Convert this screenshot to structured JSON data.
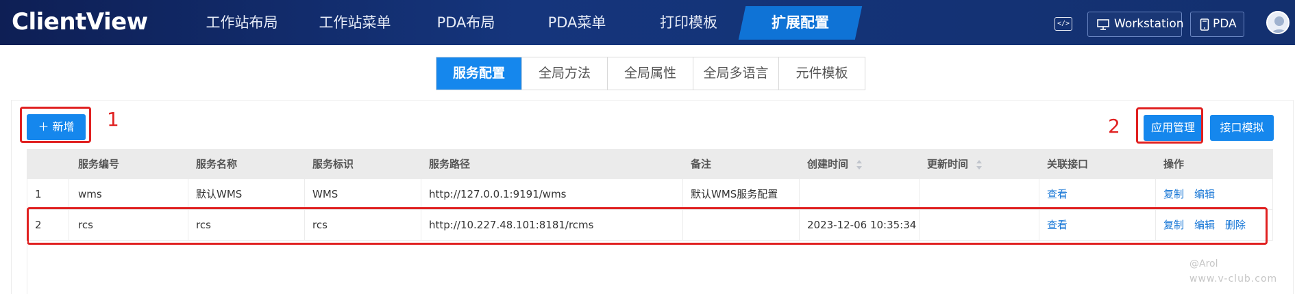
{
  "app": {
    "title": "ClientView"
  },
  "nav": {
    "items": [
      {
        "label": "工作站布局"
      },
      {
        "label": "工作站菜单"
      },
      {
        "label": "PDA布局"
      },
      {
        "label": "PDA菜单"
      },
      {
        "label": "打印模板"
      },
      {
        "label": "扩展配置"
      }
    ],
    "active_index": 5
  },
  "topright": {
    "workstation_label": "Workstation",
    "pda_label": "PDA",
    "code_icon_text": "</>"
  },
  "subtabs": [
    {
      "label": "服务配置"
    },
    {
      "label": "全局方法"
    },
    {
      "label": "全局属性"
    },
    {
      "label": "全局多语言"
    },
    {
      "label": "元件模板"
    }
  ],
  "toolbar": {
    "add_label": "＋ 新增",
    "app_manage_label": "应用管理",
    "api_mock_label": "接口模拟"
  },
  "annotations": {
    "one": "1",
    "two": "2"
  },
  "table": {
    "columns": [
      "服务编号",
      "服务名称",
      "服务标识",
      "服务路径",
      "备注",
      "创建时间",
      "更新时间",
      "关联接口",
      "操作"
    ],
    "rows": [
      {
        "index": "1",
        "code": "wms",
        "name": "默认WMS",
        "id": "WMS",
        "path": "http://127.0.0.1:9191/wms",
        "remark": "默认WMS服务配置",
        "created": "",
        "updated": "",
        "link": "查看",
        "actions": [
          "复制",
          "编辑"
        ]
      },
      {
        "index": "2",
        "code": "rcs",
        "name": "rcs",
        "id": "rcs",
        "path": "http://10.227.48.101:8181/rcms",
        "remark": "",
        "created": "2023-12-06 10:35:34",
        "updated": "",
        "link": "查看",
        "actions": [
          "复制",
          "编辑",
          "删除"
        ]
      }
    ]
  },
  "watermark": {
    "line1": "@Arol",
    "line2": "www.v-club.com"
  },
  "colors": {
    "nav_bg": "#13306f",
    "accent": "#1587ed",
    "annotation": "#e02020"
  }
}
